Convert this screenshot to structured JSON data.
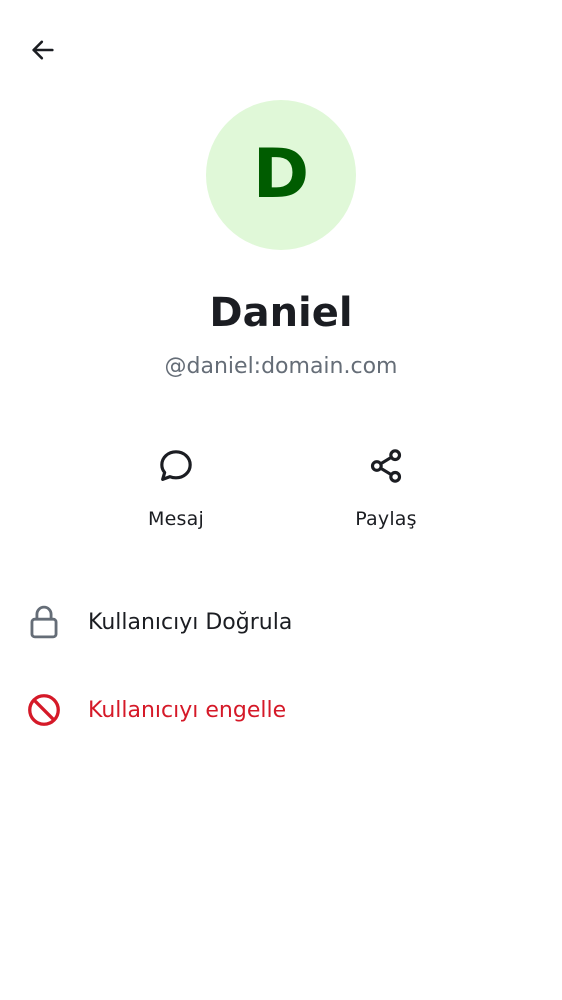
{
  "header": {
    "back_icon": "arrow-left-icon"
  },
  "profile": {
    "avatar_initial": "D",
    "avatar_bg": "#e0f8d8",
    "avatar_fg": "#005c00",
    "display_name": "Daniel",
    "user_id": "@daniel:domain.com"
  },
  "actions": {
    "message": {
      "label": "Mesaj",
      "icon": "chat-bubble-icon"
    },
    "share": {
      "label": "Paylaş",
      "icon": "share-icon"
    }
  },
  "menu": {
    "verify": {
      "label": "Kullanıcıyı Doğrula",
      "icon": "lock-icon"
    },
    "block": {
      "label": "Kullanıcıyı engelle",
      "icon": "block-icon",
      "color": "#d51928"
    }
  }
}
